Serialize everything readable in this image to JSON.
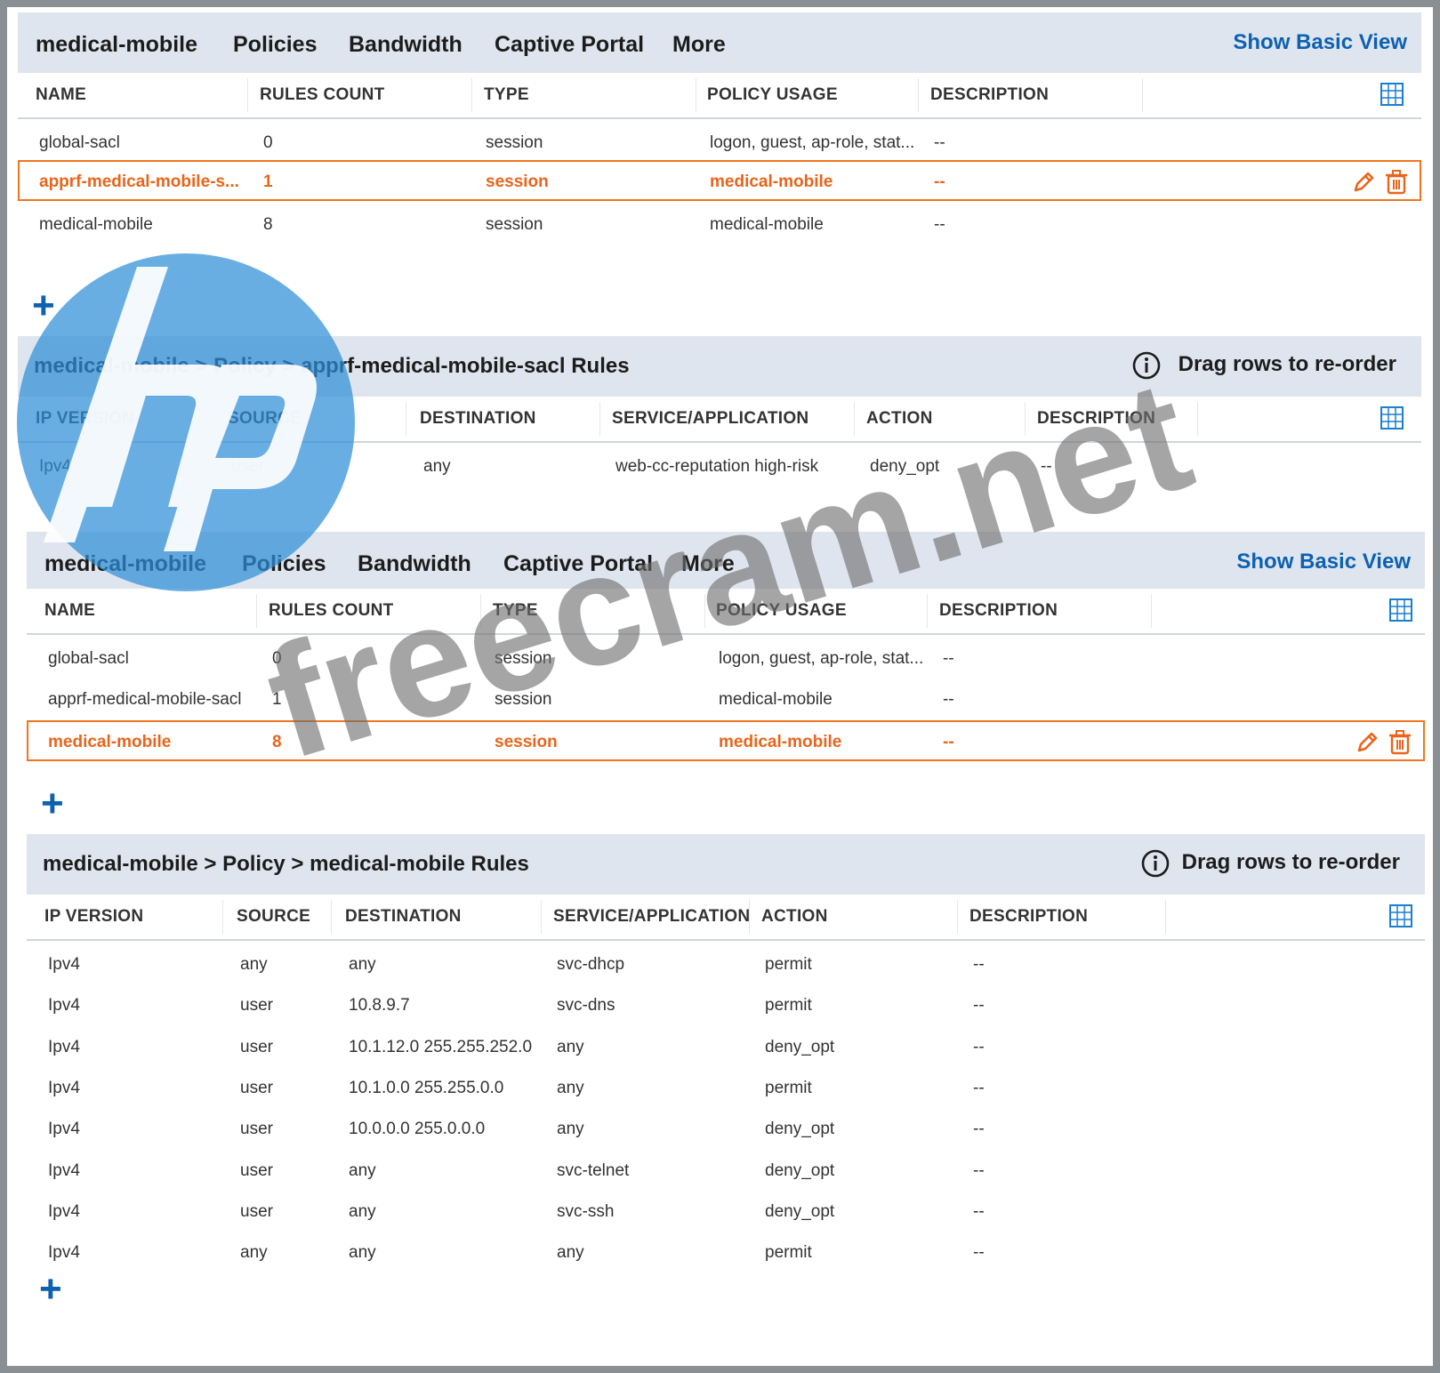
{
  "top": {
    "title": "medical-mobile",
    "tabs": [
      {
        "label": "Policies",
        "active": true
      },
      {
        "label": "Bandwidth",
        "active": false
      },
      {
        "label": "Captive Portal",
        "active": false
      },
      {
        "label": "More",
        "active": false
      }
    ],
    "show_basic_view": "Show Basic View",
    "policy_columns": [
      "NAME",
      "RULES COUNT",
      "TYPE",
      "POLICY USAGE",
      "DESCRIPTION"
    ],
    "policies": [
      {
        "name": "global-sacl",
        "rules_count": "0",
        "type": "session",
        "usage": "logon, guest, ap-role, stat...",
        "description": "--",
        "selected": false
      },
      {
        "name": "apprf-medical-mobile-s...",
        "rules_count": "1",
        "type": "session",
        "usage": "medical-mobile",
        "description": "--",
        "selected": true
      },
      {
        "name": "medical-mobile",
        "rules_count": "8",
        "type": "session",
        "usage": "medical-mobile",
        "description": "--",
        "selected": false
      }
    ],
    "add_symbol": "+",
    "breadcrumb": "medical-mobile > Policy > apprf-medical-mobile-sacl Rules",
    "drag_hint": "Drag rows to re-order",
    "rule_columns": [
      "IP VERSION",
      "SOURCE",
      "DESTINATION",
      "SERVICE/APPLICATION",
      "ACTION",
      "DESCRIPTION"
    ],
    "rules": [
      {
        "ip": "Ipv4",
        "source": "user",
        "destination": "any",
        "service": "web-cc-reputation high-risk",
        "action": "deny_opt",
        "description": "--"
      }
    ]
  },
  "bottom": {
    "title": "medical-mobile",
    "tabs": [
      {
        "label": "Policies",
        "active": true
      },
      {
        "label": "Bandwidth",
        "active": false
      },
      {
        "label": "Captive Portal",
        "active": false
      },
      {
        "label": "More",
        "active": false
      }
    ],
    "show_basic_view": "Show Basic View",
    "policy_columns": [
      "NAME",
      "RULES COUNT",
      "TYPE",
      "POLICY USAGE",
      "DESCRIPTION"
    ],
    "policies": [
      {
        "name": "global-sacl",
        "rules_count": "0",
        "type": "session",
        "usage": "logon, guest, ap-role, stat...",
        "description": "--",
        "selected": false
      },
      {
        "name": "apprf-medical-mobile-sacl",
        "rules_count": "1",
        "type": "session",
        "usage": "medical-mobile",
        "description": "--",
        "selected": false
      },
      {
        "name": "medical-mobile",
        "rules_count": "8",
        "type": "session",
        "usage": "medical-mobile",
        "description": "--",
        "selected": true
      }
    ],
    "add_symbol": "+",
    "breadcrumb": "medical-mobile > Policy > medical-mobile Rules",
    "drag_hint": "Drag rows to re-order",
    "rule_columns": [
      "IP VERSION",
      "SOURCE",
      "DESTINATION",
      "SERVICE/APPLICATION",
      "ACTION",
      "DESCRIPTION"
    ],
    "rules": [
      {
        "ip": "Ipv4",
        "source": "any",
        "destination": "any",
        "service": "svc-dhcp",
        "action": "permit",
        "description": "--"
      },
      {
        "ip": "Ipv4",
        "source": "user",
        "destination": "10.8.9.7",
        "service": "svc-dns",
        "action": "permit",
        "description": "--"
      },
      {
        "ip": "Ipv4",
        "source": "user",
        "destination": "10.1.12.0 255.255.252.0",
        "service": "any",
        "action": "deny_opt",
        "description": "--"
      },
      {
        "ip": "Ipv4",
        "source": "user",
        "destination": "10.1.0.0 255.255.0.0",
        "service": "any",
        "action": "permit",
        "description": "--"
      },
      {
        "ip": "Ipv4",
        "source": "user",
        "destination": "10.0.0.0 255.0.0.0",
        "service": "any",
        "action": "deny_opt",
        "description": "--"
      },
      {
        "ip": "Ipv4",
        "source": "user",
        "destination": "any",
        "service": "svc-telnet",
        "action": "deny_opt",
        "description": "--"
      },
      {
        "ip": "Ipv4",
        "source": "user",
        "destination": "any",
        "service": "svc-ssh",
        "action": "deny_opt",
        "description": "--"
      },
      {
        "ip": "Ipv4",
        "source": "any",
        "destination": "any",
        "service": "any",
        "action": "permit",
        "description": "--"
      }
    ]
  },
  "watermark": {
    "logo": "hp",
    "text": "freecram.net"
  },
  "colors": {
    "accent": "#f0751e",
    "link": "#0d61b0",
    "header_bg": "#dfe5ee",
    "logo_blue": "#2f8fd8"
  }
}
